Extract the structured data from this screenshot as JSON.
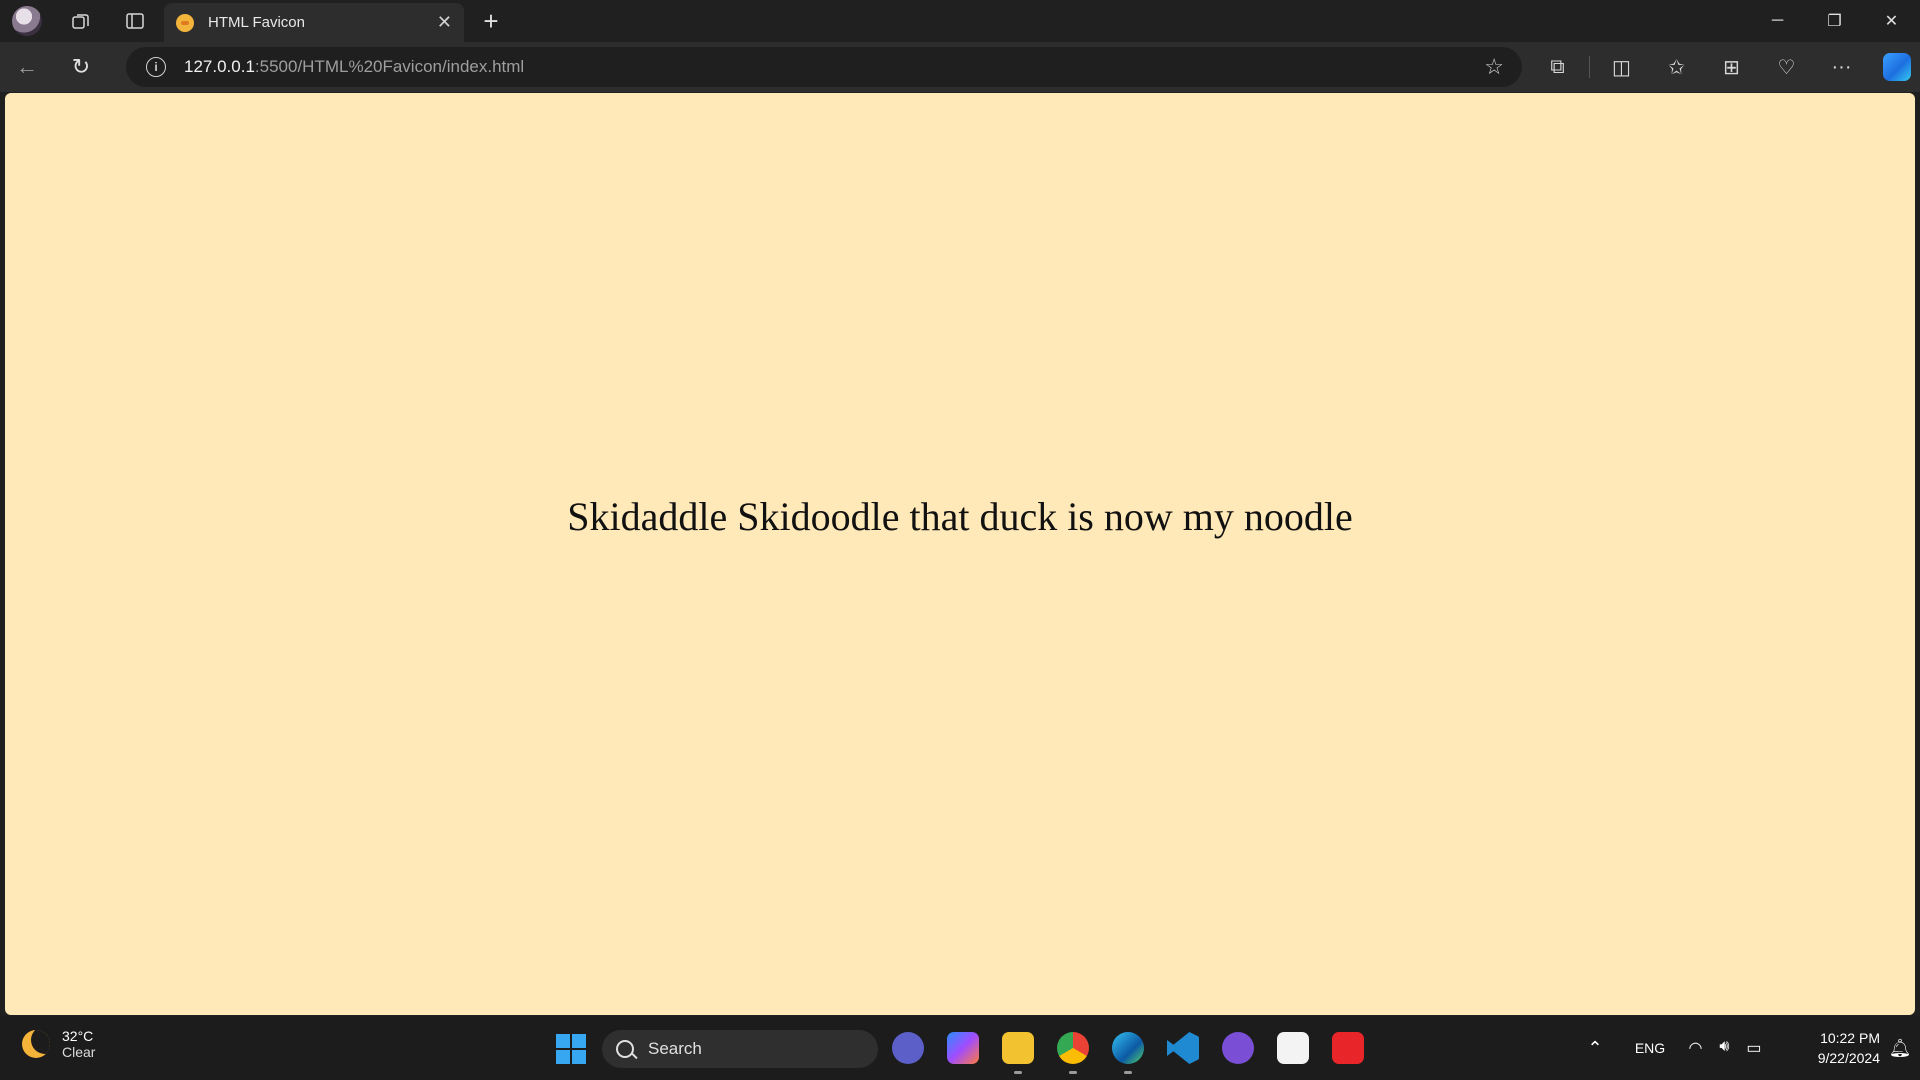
{
  "browser": {
    "tab_title": "HTML Favicon",
    "url_host": "127.0.0.1",
    "url_rest": ":5500/HTML%20Favicon/index.html"
  },
  "page": {
    "message": "Skidaddle Skidoodle that duck is now my noodle",
    "background_color": "#ffe9b8"
  },
  "taskbar": {
    "weather_temp": "32°C",
    "weather_desc": "Clear",
    "search_label": "Search",
    "language": "ENG",
    "time": "10:22 PM",
    "date": "9/22/2024"
  }
}
